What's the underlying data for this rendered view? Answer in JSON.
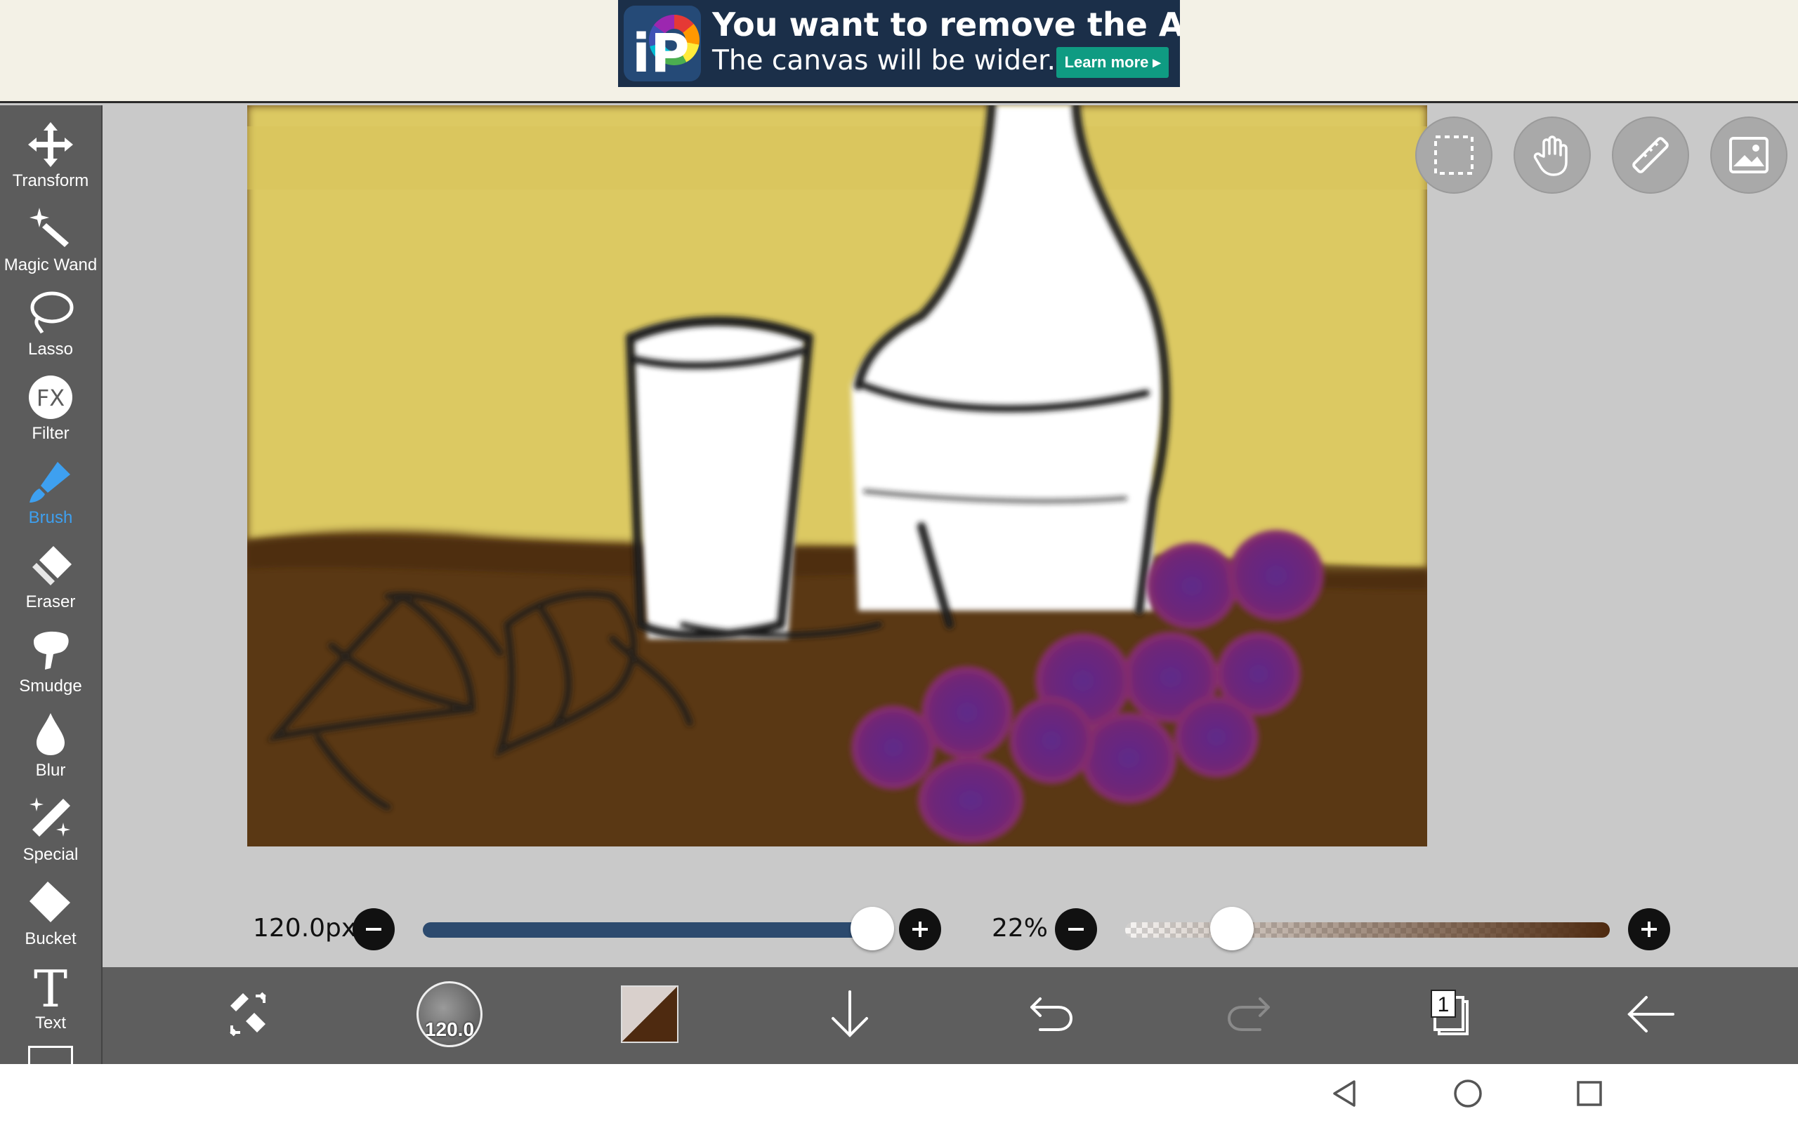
{
  "ad": {
    "logo_text": "iP",
    "title": "You want to remove the Ad?",
    "subtitle": "The canvas will be wider.",
    "button_label": "Learn more"
  },
  "tools": [
    {
      "label": "Transform",
      "icon": "transform-icon"
    },
    {
      "label": "Magic Wand",
      "icon": "magic-wand-icon"
    },
    {
      "label": "Lasso",
      "icon": "lasso-icon"
    },
    {
      "label": "Filter",
      "icon": "fx-icon"
    },
    {
      "label": "Brush",
      "icon": "brush-icon",
      "active": true
    },
    {
      "label": "Eraser",
      "icon": "eraser-icon"
    },
    {
      "label": "Smudge",
      "icon": "smudge-icon"
    },
    {
      "label": "Blur",
      "icon": "blur-drop-icon"
    },
    {
      "label": "Special",
      "icon": "special-icon"
    },
    {
      "label": "Bucket",
      "icon": "bucket-icon"
    },
    {
      "label": "Text",
      "icon": "text-icon"
    }
  ],
  "floating_buttons": [
    "selection-icon",
    "hand-icon",
    "ruler-icon",
    "image-icon"
  ],
  "brush": {
    "size_label": "120.0px",
    "size_fraction": 0.97,
    "opacity_label": "22%",
    "opacity_fraction": 0.22,
    "size_badge": "120.0"
  },
  "layers": {
    "count": "1"
  },
  "colors": {
    "accent": "#3ea0f0",
    "size_track": "#2c4a6e",
    "primary": "#4e2a10",
    "secondary": "#d9d0cc",
    "background_yellow": "#dcc962",
    "table_brown": "#5a3814",
    "grape": "#7a2a7e"
  }
}
